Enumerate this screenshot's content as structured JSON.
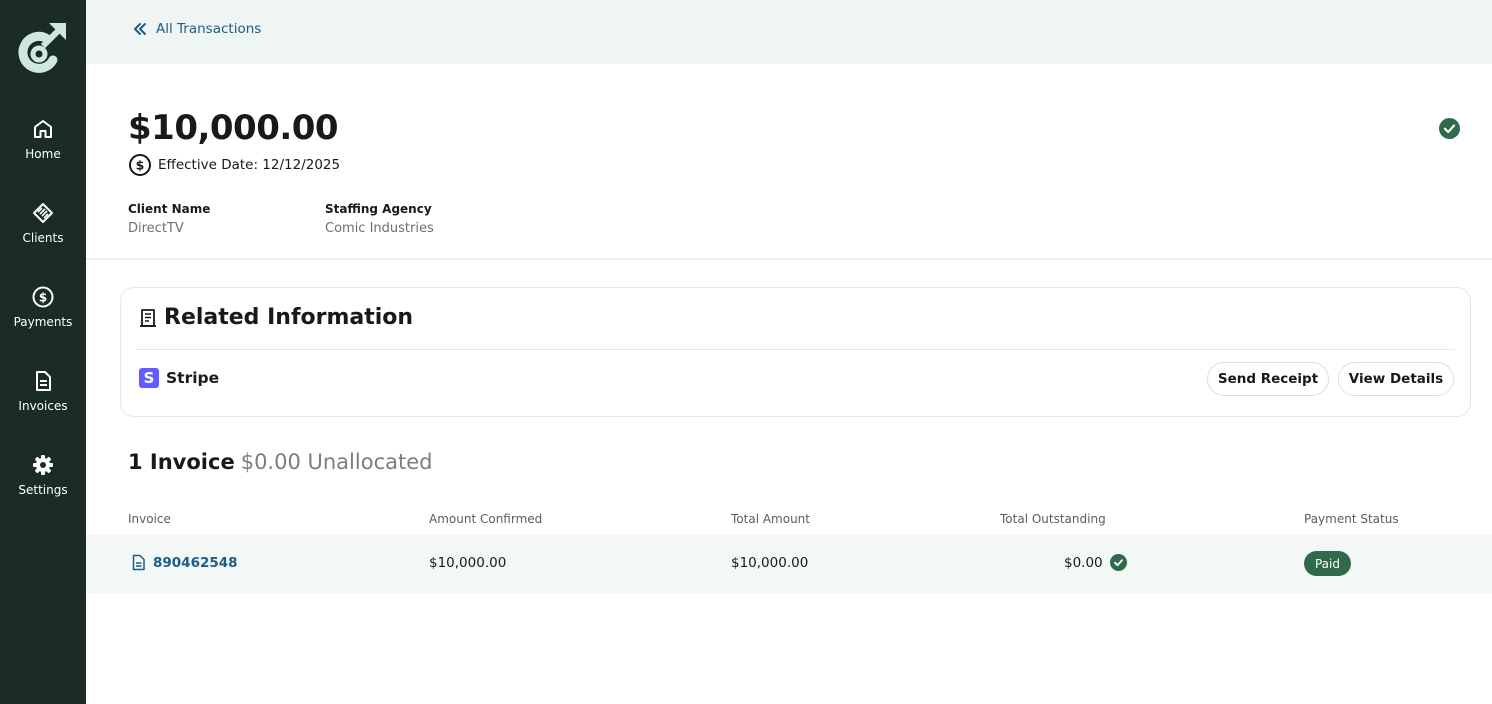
{
  "sidebar": {
    "items": [
      {
        "label": "Home",
        "icon": "home-icon"
      },
      {
        "label": "Clients",
        "icon": "handshake-icon"
      },
      {
        "label": "Payments",
        "icon": "dollar-circle-icon"
      },
      {
        "label": "Invoices",
        "icon": "document-icon"
      },
      {
        "label": "Settings",
        "icon": "gear-icon"
      }
    ]
  },
  "topbar": {
    "back_label": "All Transactions"
  },
  "transaction": {
    "amount": "$10,000.00",
    "effective_date": "Effective Date: 12/12/2025",
    "client_name_label": "Client Name",
    "client_name": "DirectTV",
    "agency_label": "Staffing Agency",
    "agency": "Comic Industries"
  },
  "related": {
    "title": "Related Information",
    "provider": "Stripe",
    "provider_logo_letter": "S",
    "send_receipt": "Send Receipt",
    "view_details": "View Details"
  },
  "invoices": {
    "count_label": "1 Invoice",
    "unallocated": "$0.00 Unallocated",
    "columns": [
      "Invoice",
      "Amount Confirmed",
      "Total Amount",
      "Total Outstanding",
      "Payment Status"
    ],
    "rows": [
      {
        "invoice": "890462548",
        "amount_confirmed": "$10,000.00",
        "total_amount": "$10,000.00",
        "total_outstanding": "$0.00",
        "status": "Paid"
      }
    ]
  },
  "colors": {
    "sidebar_bg": "#1b2b27",
    "accent_green": "#2f6a4b",
    "link_blue": "#1d5d86",
    "topbar_bg": "#eef5f3"
  }
}
